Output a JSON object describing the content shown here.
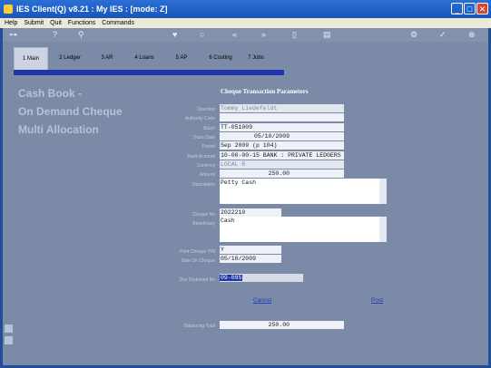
{
  "window": {
    "title": "IES Client(Q) v8.21 : My IES :    [mode: Z]"
  },
  "menu": [
    "Help",
    "Submit",
    "Quit",
    "Functions",
    "Commands"
  ],
  "tabs": [
    {
      "label": "1 Main",
      "active": true
    },
    {
      "label": "2 Ledger",
      "active": false
    },
    {
      "label": "3 AR",
      "active": false
    },
    {
      "label": "4 Loans",
      "active": false
    },
    {
      "label": "5 AP",
      "active": false
    },
    {
      "label": "6 Costing",
      "active": false
    },
    {
      "label": "7 Jobs",
      "active": false
    }
  ],
  "background": {
    "line1": "Cash Book -",
    "line2": "On Demand Cheque",
    "line3": "Multi Allocation"
  },
  "form": {
    "heading": "Cheque Transaction Parameters",
    "labels": {
      "operator": "Operator",
      "authority_code": "Authority Code",
      "batch": "Batch",
      "trans_date": "Trans Date",
      "period": "Period",
      "bank_account": "Bank Account",
      "currency": "Currency",
      "amount": "Amount",
      "description": "Description",
      "cheque_no": "Cheque No",
      "beneficiary": "Beneficiary",
      "print_cheque": "Print Cheque Y/N",
      "date_on_cheque": "Date On Cheque",
      "doc_deducted": "Doc Deducted No",
      "balancing_total": "Balancing Total"
    },
    "values": {
      "operator": "Tommy Liedefeldt",
      "authority_code": "",
      "batch": "TT-051009",
      "trans_date": "05/10/2009",
      "period": "Sep 2009 (p 104)",
      "bank_account": "10-00-00-15 BANK : PRIVATE LEDGERS",
      "currency": "LOCAL R",
      "amount": "250.00",
      "description": "Petty Cash",
      "cheque_no": "2022210",
      "beneficiary": "Cash",
      "print_cheque": "Y",
      "date_on_cheque": "05/10/2009",
      "doc_deducted": "09-095",
      "balancing_total": "250.00"
    }
  },
  "actions": {
    "cancel": "Cancel",
    "post": "Post"
  }
}
